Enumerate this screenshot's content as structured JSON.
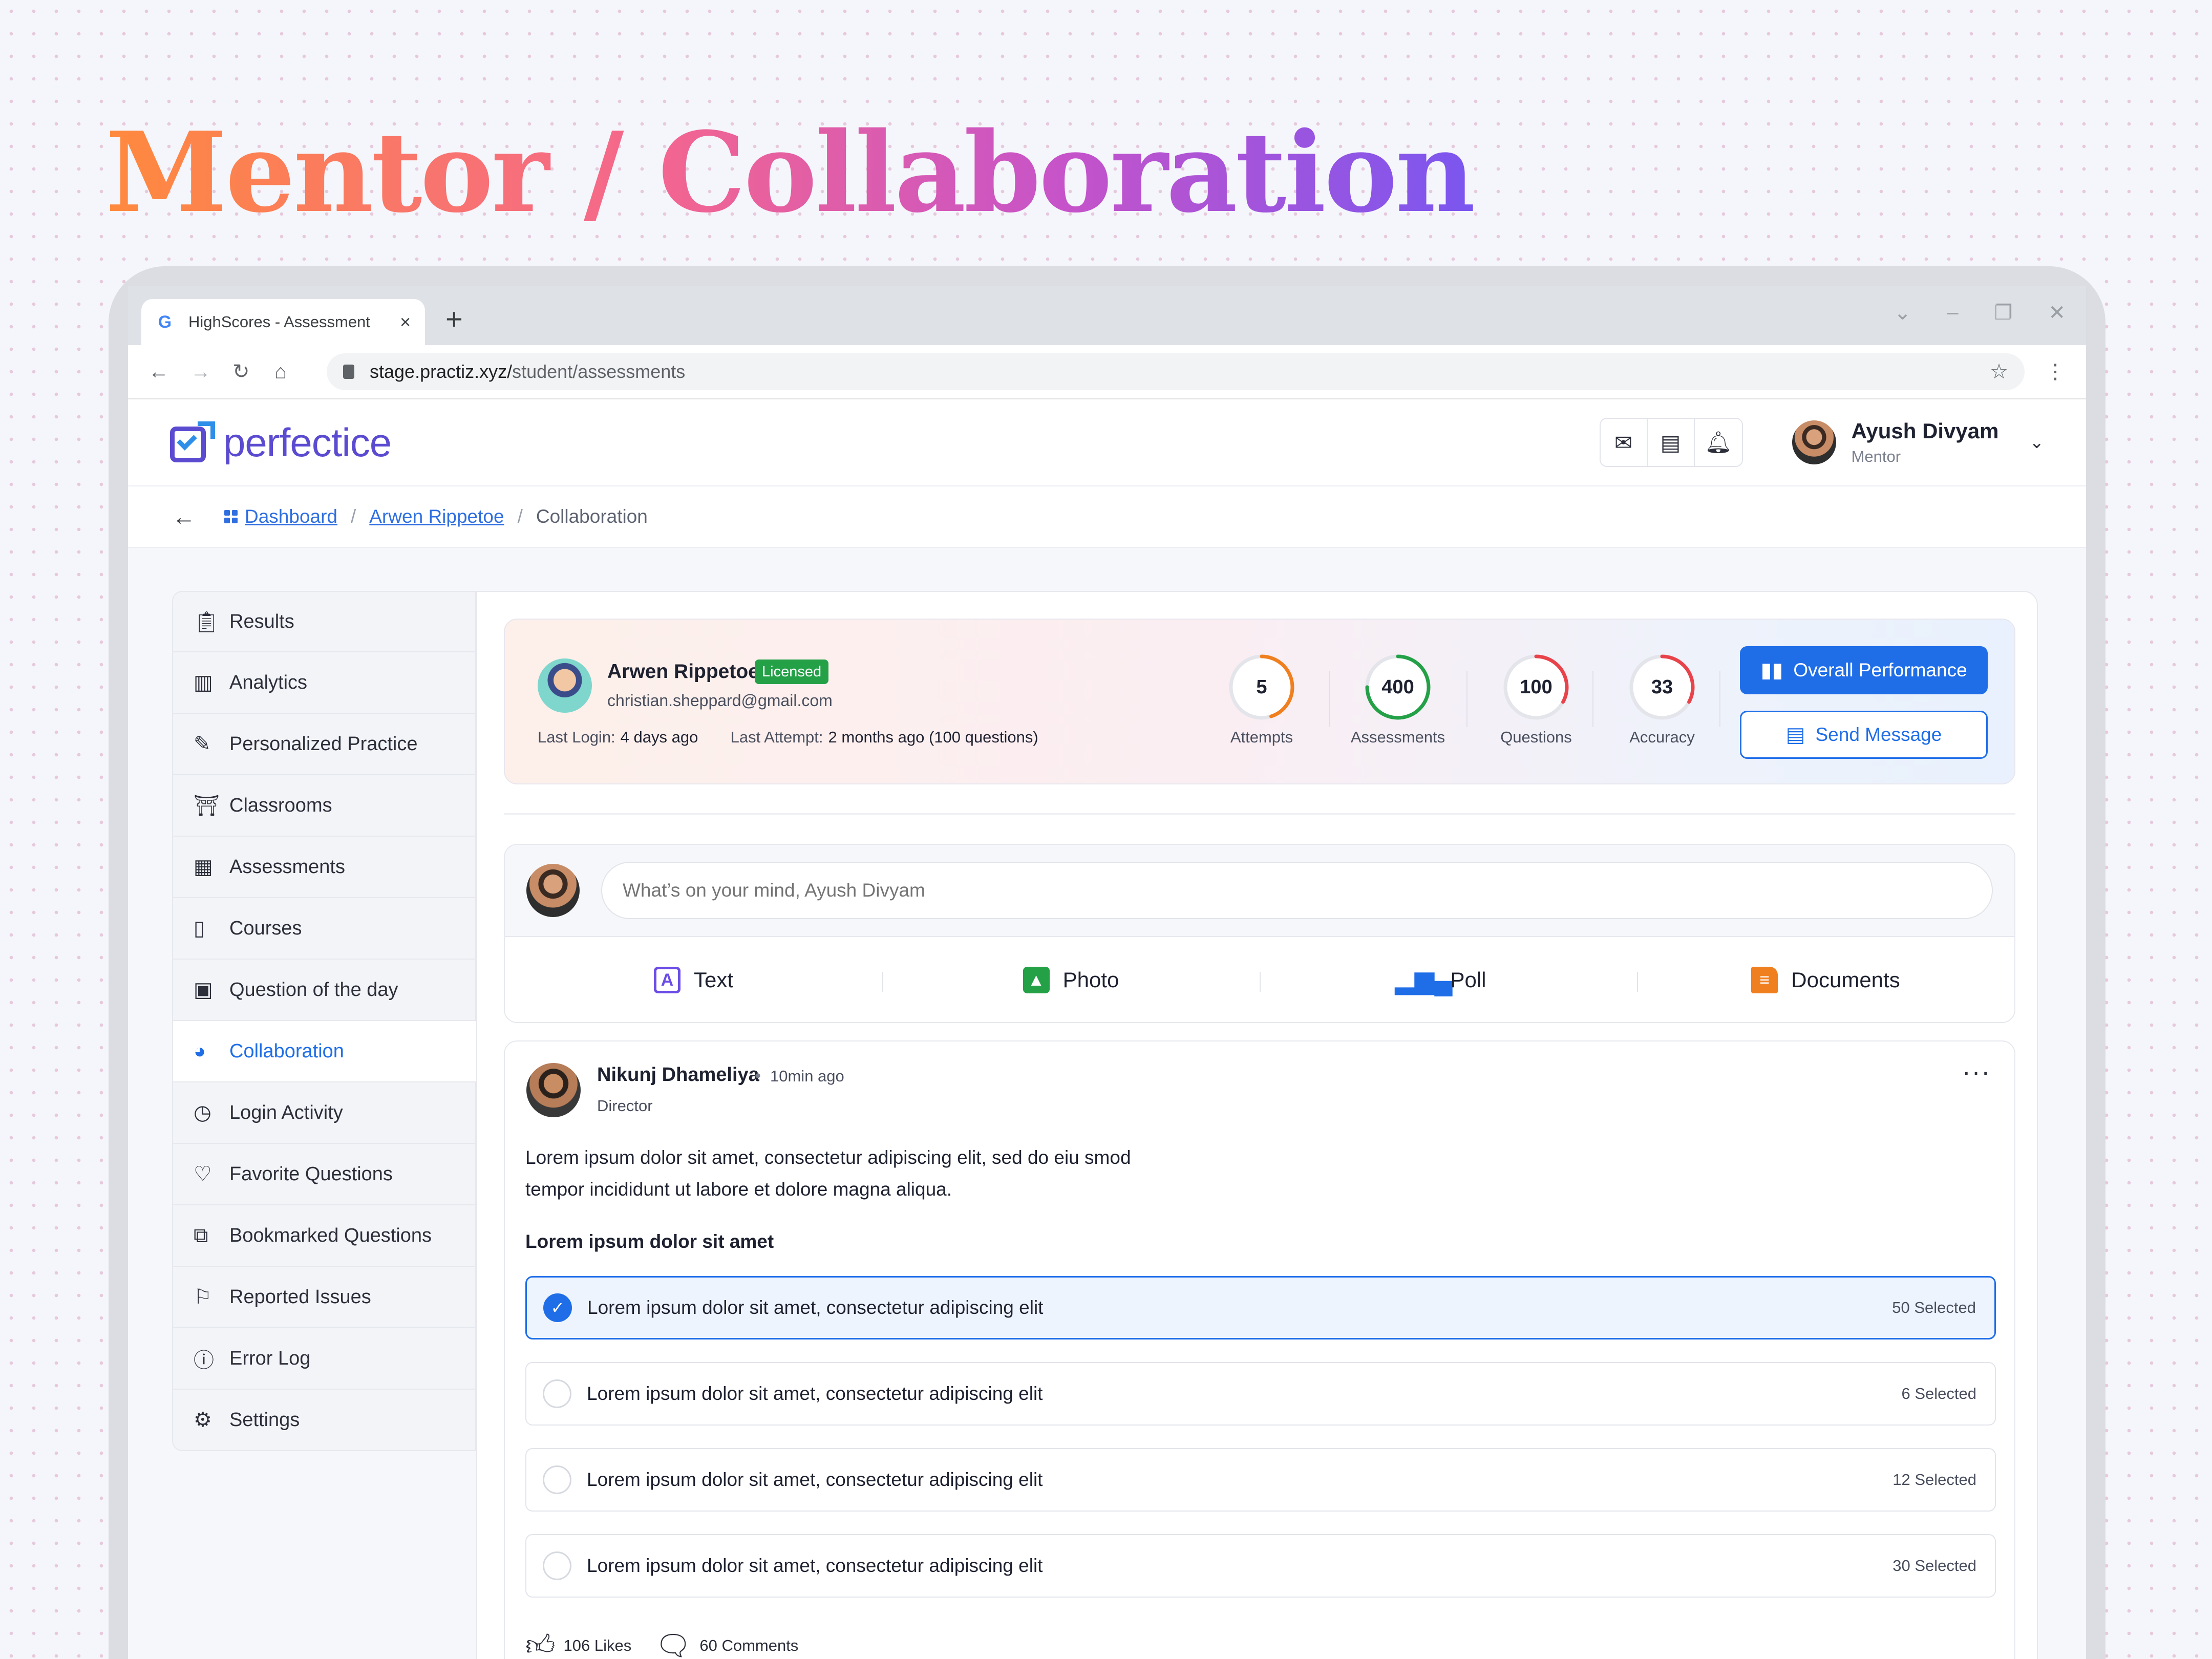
{
  "hero": {
    "title": "Mentor / Collaboration"
  },
  "browser": {
    "tab_title": "HighScores - Assessment",
    "tab_close": "×",
    "new_tab": "+",
    "url_host": "stage.practiz.xyz/",
    "url_path": "student/assessments"
  },
  "app": {
    "logo_text": "perfectice",
    "user": {
      "name": "Ayush Divyam",
      "role": "Mentor"
    }
  },
  "breadcrumb": {
    "items": [
      "Dashboard",
      "Arwen Rippetoe"
    ],
    "separator": "/",
    "current": "Collaboration"
  },
  "sidebar": {
    "items": [
      {
        "label": "Results",
        "icon": "clipboard-icon"
      },
      {
        "label": "Analytics",
        "icon": "bar-chart-icon"
      },
      {
        "label": "Personalized Practice",
        "icon": "pen-icon"
      },
      {
        "label": "Classrooms",
        "icon": "classroom-icon"
      },
      {
        "label": "Assessments",
        "icon": "assessment-icon"
      },
      {
        "label": "Courses",
        "icon": "book-icon"
      },
      {
        "label": "Question of the day",
        "icon": "calendar-icon"
      },
      {
        "label": "Collaboration",
        "icon": "collaboration-icon",
        "active": true
      },
      {
        "label": "Login Activity",
        "icon": "clock-icon"
      },
      {
        "label": "Favorite Questions",
        "icon": "heart-icon"
      },
      {
        "label": "Bookmarked Questions",
        "icon": "bookmark-icon"
      },
      {
        "label": "Reported Issues",
        "icon": "flag-icon"
      },
      {
        "label": "Error Log",
        "icon": "alert-icon"
      },
      {
        "label": "Settings",
        "icon": "gear-icon"
      }
    ]
  },
  "profile": {
    "name": "Arwen Rippetoe",
    "badge": "Licensed",
    "email": "christian.sheppard@gmail.com",
    "last_login_label": "Last Login:",
    "last_login_value": "4 days ago",
    "last_attempt_label": "Last Attempt:",
    "last_attempt_value": "2 months ago (100 questions)",
    "stats": [
      {
        "value": "5",
        "label": "Attempts",
        "progress": 0.45,
        "color": "#f07f1f"
      },
      {
        "value": "400",
        "label": "Assessments",
        "progress": 0.75,
        "color": "#24a047"
      },
      {
        "value": "100",
        "label": "Questions",
        "progress": 0.33,
        "color": "#e8434a"
      },
      {
        "value": "33",
        "label": "Accuracy",
        "progress": 0.33,
        "color": "#e8434a"
      }
    ],
    "overall_btn": "Overall Performance",
    "message_btn": "Send Message"
  },
  "composer": {
    "placeholder": "What’s on your mind, Ayush Divyam",
    "actions": [
      {
        "label": "Text",
        "icon": "text-icon",
        "color": "#6b4ce6"
      },
      {
        "label": "Photo",
        "icon": "photo-icon",
        "color": "#24a047"
      },
      {
        "label": "Poll",
        "icon": "poll-icon",
        "color": "#1f6ee8"
      },
      {
        "label": "Documents",
        "icon": "document-icon",
        "color": "#f07f1f"
      }
    ]
  },
  "post": {
    "author": "Nikunj Dhameliya",
    "time": "10min ago",
    "role": "Director",
    "body": "Lorem ipsum dolor sit amet, consectetur adipiscing elit, sed do eiu smod tempor incididunt ut labore et dolore magna aliqua.",
    "poll_question": "Lorem ipsum dolor sit amet",
    "options": [
      {
        "text": "Lorem ipsum dolor sit amet, consectetur adipiscing elit",
        "count": "50 Selected",
        "selected": true
      },
      {
        "text": "Lorem ipsum dolor sit amet, consectetur adipiscing elit",
        "count": "6 Selected",
        "selected": false
      },
      {
        "text": "Lorem ipsum dolor sit amet, consectetur adipiscing elit",
        "count": "12 Selected",
        "selected": false
      },
      {
        "text": "Lorem ipsum dolor sit amet, consectetur adipiscing elit",
        "count": "30 Selected",
        "selected": false
      }
    ],
    "likes": "106 Likes",
    "comments": "60 Comments"
  },
  "colors": {
    "primary": "#1f6ee8",
    "brand": "#5b4bd1",
    "licensed": "#24a047"
  }
}
